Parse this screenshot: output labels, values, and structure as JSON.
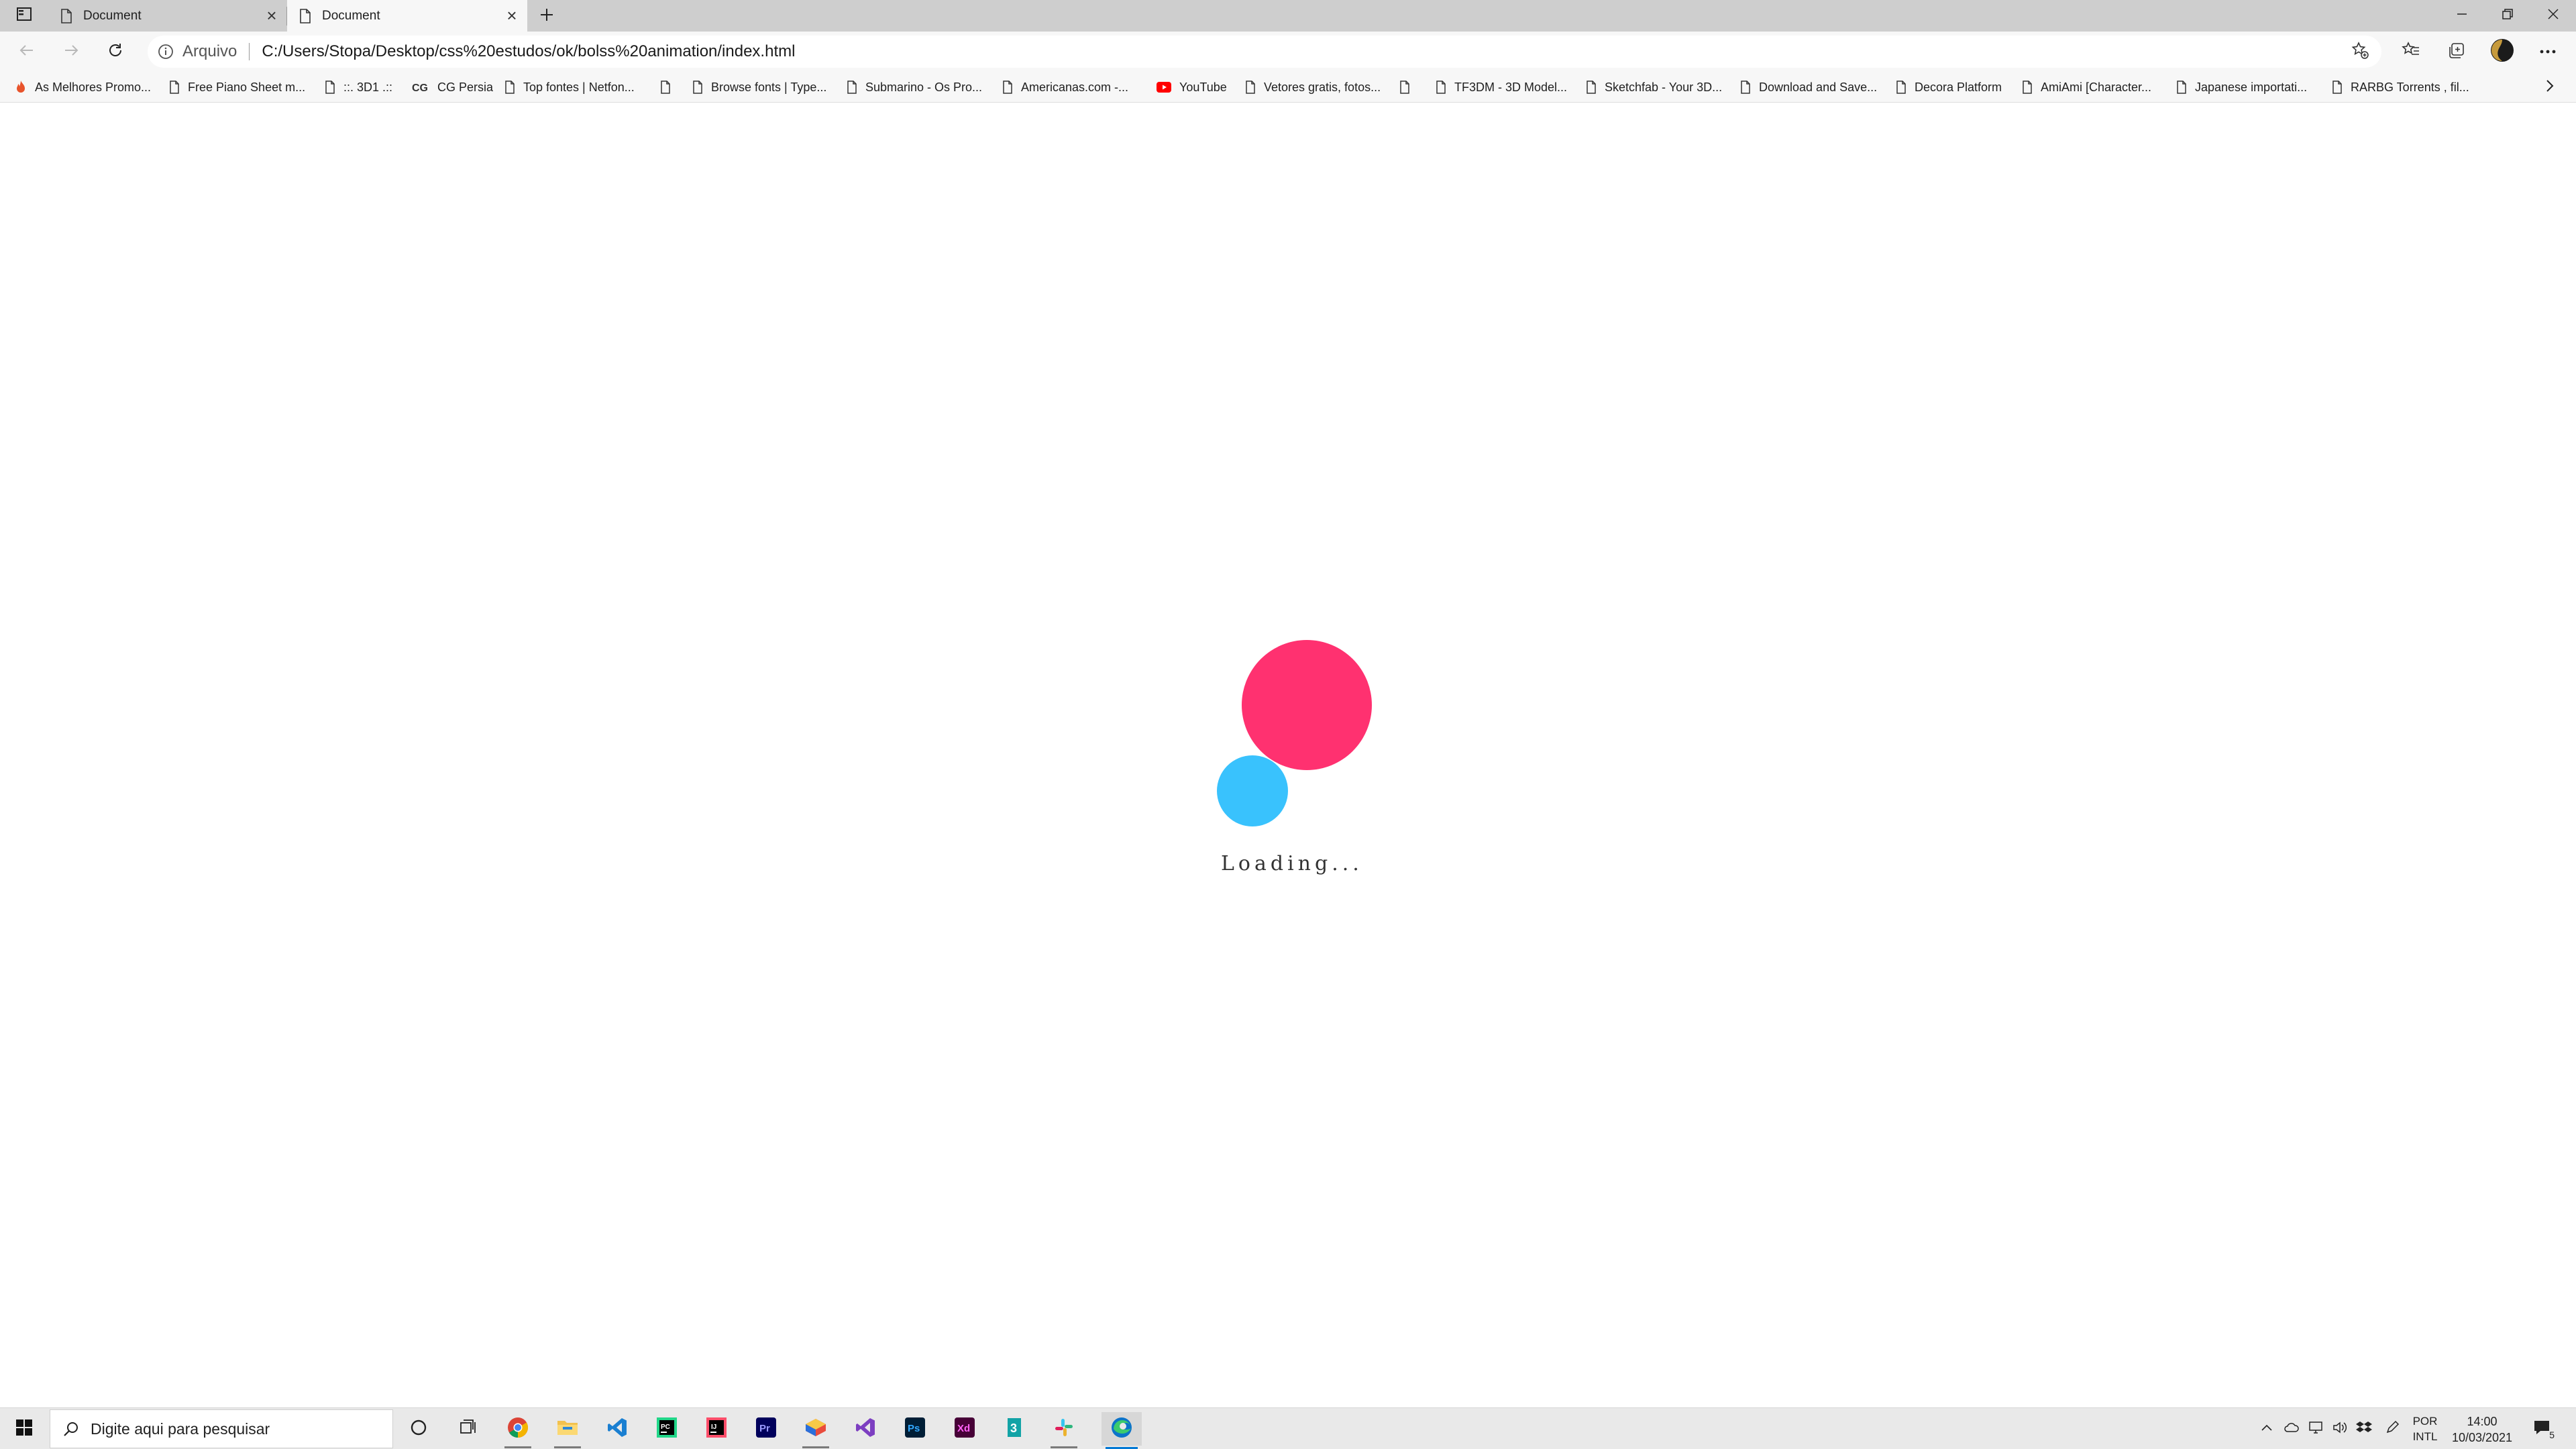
{
  "browser": {
    "tabs": [
      {
        "title": "Document",
        "active": false
      },
      {
        "title": "Document",
        "active": true
      }
    ],
    "address": {
      "label": "Arquivo",
      "url": "C:/Users/Stopa/Desktop/css%20estudos/ok/bolss%20animation/index.html"
    },
    "bookmarks": [
      {
        "label": "As Melhores Promo...",
        "icon": "fire-icon"
      },
      {
        "label": "Free Piano Sheet m...",
        "icon": "page-icon"
      },
      {
        "label": "::. 3D1 .::",
        "icon": "page-icon"
      },
      {
        "label": "CG Persia",
        "icon": "cgpersia-icon"
      },
      {
        "label": "Top fontes | Netfon...",
        "icon": "page-icon"
      },
      {
        "label": "",
        "icon": "page-icon"
      },
      {
        "label": "Browse fonts | Type...",
        "icon": "page-icon"
      },
      {
        "label": "Submarino - Os Pro...",
        "icon": "page-icon"
      },
      {
        "label": "Americanas.com -...",
        "icon": "page-icon"
      },
      {
        "label": "YouTube",
        "icon": "youtube-icon"
      },
      {
        "label": "Vetores gratis, fotos...",
        "icon": "page-icon"
      },
      {
        "label": "",
        "icon": "page-icon"
      },
      {
        "label": "TF3DM - 3D Model...",
        "icon": "page-icon"
      },
      {
        "label": "Sketchfab - Your 3D...",
        "icon": "page-icon"
      },
      {
        "label": "Download and Save...",
        "icon": "page-icon"
      },
      {
        "label": "Decora Platform",
        "icon": "page-icon"
      },
      {
        "label": "AmiAmi [Character...",
        "icon": "page-icon"
      },
      {
        "label": "Japanese importati...",
        "icon": "page-icon"
      },
      {
        "label": "RARBG Torrents , fil...",
        "icon": "page-icon"
      }
    ]
  },
  "page": {
    "loading_text": "Loading...",
    "colors": {
      "pink_ball": "#ff3170",
      "blue_ball": "#39c2fd"
    }
  },
  "taskbar": {
    "search_placeholder": "Digite aqui para pesquisar",
    "apps": [
      "cortana-icon",
      "task-view-icon",
      "chrome-icon",
      "file-explorer-icon",
      "vscode-icon",
      "pycharm-icon",
      "intellij-icon",
      "premiere-icon",
      "sketchup-icon",
      "visual-studio-icon",
      "photoshop-icon",
      "adobe-xd-icon",
      "3ds-max-icon",
      "slack-icon",
      "edge-icon"
    ],
    "language": {
      "line1": "POR",
      "line2": "INTL"
    },
    "clock": {
      "time": "14:00",
      "date": "10/03/2021"
    },
    "notification_count": "5"
  }
}
